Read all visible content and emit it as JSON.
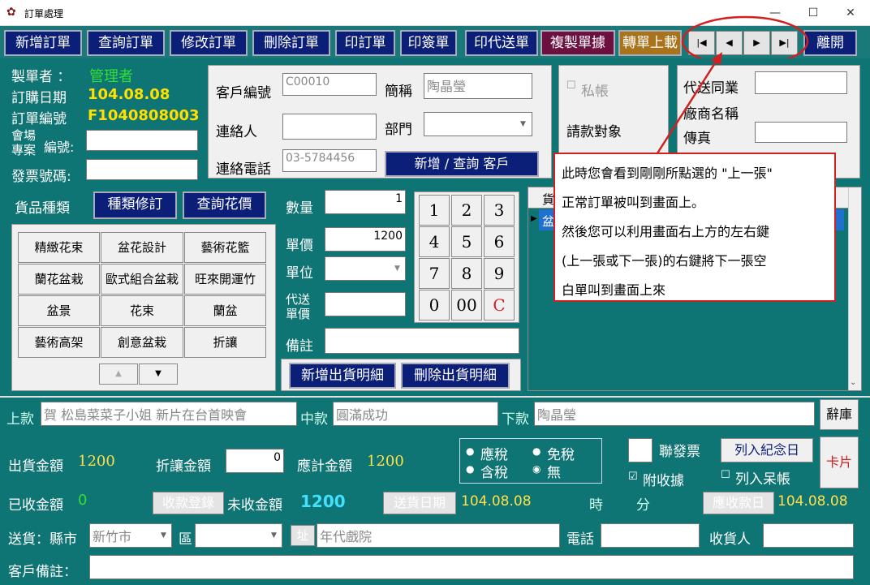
{
  "window": {
    "title": "訂單處理",
    "minimize": "—",
    "maximize": "☐",
    "close": "✕"
  },
  "toolbar": {
    "buttons": [
      "新增訂單",
      "查詢訂單",
      "修改訂單",
      "刪除訂單",
      "印訂單",
      "印簽單",
      "印代送單",
      "複製單據",
      "轉單上載",
      "離開"
    ],
    "nav": [
      "|◀",
      "◀",
      "▶",
      "▶|"
    ]
  },
  "header": {
    "maker_label": "製單者 ：",
    "maker": "管理者",
    "date_label": "訂購日期",
    "date": "104.08.08",
    "order_label": "訂單編號",
    "order_no": "F1040808003",
    "venue_label_1": "會場",
    "venue_label_2": "專案",
    "venue_label_3": "編號:",
    "invoice_label": "發票號碼:"
  },
  "customer": {
    "id_label": "客戶編號",
    "id": "C00010",
    "short_label": "簡稱",
    "short": "陶晶瑩",
    "contact_label": "連絡人",
    "dept_label": "部門",
    "phone_label": "連絡電話",
    "phone": "03-5784456",
    "add_btn": "新增 / 查詢  客戶"
  },
  "private": {
    "check": "私帳",
    "billing_label": "請款對象"
  },
  "agent": {
    "peer_label": "代送同業",
    "vendor_label": "廠商名稱",
    "fax_label": "傳真"
  },
  "callout": {
    "lines": [
      "此時您會看到剛剛所點選的 \"上一張\"",
      "正常訂單被叫到畫面上。",
      "然後您可以利用畫面右上方的左右鍵",
      "(上一張或下一張)的右鍵將下一張空",
      "白單叫到畫面上來"
    ]
  },
  "goods": {
    "category_label": "貨品種類",
    "edit_btn": "種類修訂",
    "price_btn": "查詢花價",
    "items": [
      "精緻花束",
      "盆花設計",
      "藝術花籃",
      "蘭花盆栽",
      "歐式組合盆栽",
      "旺來開運竹",
      "盆景",
      "花束",
      "蘭盆",
      "藝術高架",
      "創意盆栽",
      "折讓"
    ],
    "up": "▲",
    "down": "▼"
  },
  "detail": {
    "qty_label": "數量",
    "qty": "1",
    "price_label": "單價",
    "price": "1200",
    "unit_label": "單位",
    "agent_price_label_1": "代送",
    "agent_price_label_2": "單價",
    "note_label": "備註",
    "add_btn": "新增出貨明細",
    "del_btn": "刪除出貨明細"
  },
  "keypad": [
    "1",
    "2",
    "3",
    "4",
    "5",
    "6",
    "7",
    "8",
    "9",
    "0",
    "00",
    "C"
  ],
  "grid": {
    "header": "貨",
    "row": "盆"
  },
  "message": {
    "top_label": "上款",
    "top": "賀 松島菜菜子小姐  新片在台首映會",
    "mid_label": "中款",
    "mid": "圓滿成功",
    "bottom_label": "下款",
    "bottom": "陶晶瑩",
    "lib_btn": "辭庫"
  },
  "amounts": {
    "ship_label": "出貨金額",
    "ship": "1200",
    "discount_label": "折讓金額",
    "discount": "0",
    "due_label": "應計金額",
    "due": "1200",
    "received_label": "已收金額",
    "received": "0",
    "receipt_btn": "收款登錄",
    "unpaid_label": "未收金額",
    "unpaid": "1200",
    "deliver_btn": "送貨日期",
    "deliver_date": "104.08.08",
    "hour_label": "時",
    "min_label": "分",
    "receivable_btn": "應收款日",
    "receivable_date": "104.08.08"
  },
  "tax": {
    "taxed": "應稅",
    "tax_inc": "含稅",
    "free": "免稅",
    "none": "無"
  },
  "invoice": {
    "joint": "聯發票",
    "memorial_btn": "列入紀念日",
    "attach": "附收據",
    "bad": "列入呆帳",
    "card_btn": "卡片"
  },
  "delivery": {
    "label": "送貨：縣市",
    "city": "新竹市",
    "district_label": "區",
    "addr_btn": "址",
    "address": "年代戲院",
    "phone_label": "電話",
    "receiver_label": "收貨人"
  },
  "remark": {
    "label": "客戶備註："
  }
}
